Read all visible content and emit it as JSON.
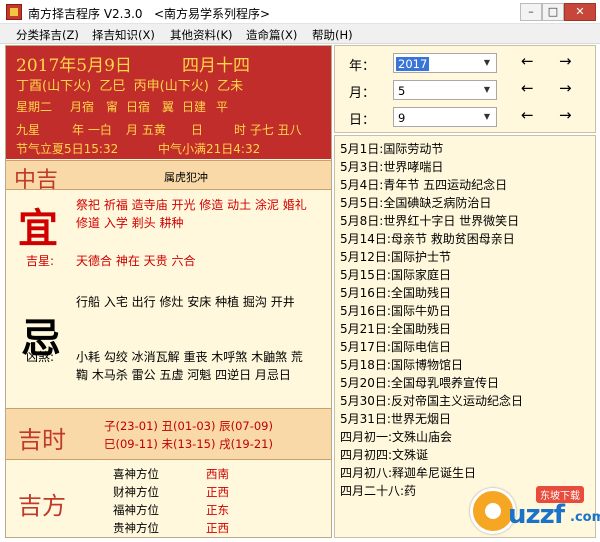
{
  "window": {
    "title": "南方择吉程序 V2.3.0   <南方易学系列程序>",
    "min_label": "–",
    "max_label": "□",
    "close_label": "✕"
  },
  "menu": [
    "分类择吉(Z)",
    "择吉知识(X)",
    "其他资料(K)",
    "造命篇(X)",
    "帮助(H)"
  ],
  "header": {
    "solar_date": "2017年5月9日",
    "lunar_date": "四月十四",
    "ganzhi": "丁酉(山下火)  乙巳  丙申(山下火)  乙未",
    "weekday": "星期二",
    "xiu": "月宿",
    "xiu_name": "甯",
    "ri_xiu": "日宿",
    "ri_xiu_name": "翼",
    "rijian": "日建",
    "rijian_name": "平",
    "jiuxing_label": "九星",
    "year_star": "年 一白",
    "month_star": "月 五黄",
    "day_star": "日",
    "hour_star": "时 子七 丑八",
    "jieqi_prev": "节气立夏5日15:32",
    "jieqi_next": "中气小满21日4:32"
  },
  "day_quality": "中吉",
  "conflict": "属虎犯冲",
  "yi": {
    "char": "宜",
    "line1": "祭祀 祈福 造寺庙 开光 修造 动土 涂泥 婚礼",
    "line2": "修道 入学 剃头 耕种",
    "jishen_label": "吉星:",
    "jishen": "天德合 神在 天贵 六合"
  },
  "ji": {
    "char": "忌",
    "line1": "行船 入宅 出行 修灶 安床 种植 掘沟 开井",
    "xiongsha_label": "凶煞:",
    "xiongsha_line1": "小耗 勾绞 冰消瓦解 重丧 木呼煞 木鼬煞 荒",
    "xiongsha_line2": "鞫 木马杀 雷公 五虚 河魁 四逆日 月忌日"
  },
  "jishi": {
    "title": "吉时",
    "line1": "子(23-01) 丑(01-03) 辰(07-09)",
    "line2": "巳(09-11) 未(13-15) 戌(19-21)"
  },
  "jifang": {
    "title": "吉方",
    "items": [
      {
        "label": "喜神方位",
        "value": "西南"
      },
      {
        "label": "财神方位",
        "value": "正西"
      },
      {
        "label": "福神方位",
        "value": "正东"
      },
      {
        "label": "贵神方位",
        "value": "正西"
      }
    ]
  },
  "selectors": {
    "year_label": "年：",
    "year_value": "2017",
    "month_label": "月：",
    "month_value": "5",
    "day_label": "日：",
    "day_value": "9",
    "prev": "←",
    "next": "→"
  },
  "festivals": [
    "5月1日:国际劳动节",
    "5月3日:世界哮喘日",
    "5月4日:青年节 五四运动纪念日",
    "5月5日:全国碘缺乏病防治日",
    "5月8日:世界红十字日 世界微笑日",
    "5月14日:母亲节 救助贫困母亲日",
    "5月12日:国际护士节",
    "5月15日:国际家庭日",
    "5月16日:全国助残日",
    "5月16日:国际牛奶日",
    "5月21日:全国助残日",
    "5月17日:国际电信日",
    "5月18日:国际博物馆日",
    "5月20日:全国母乳喂养宣传日",
    "5月30日:反对帝国主义运动纪念日",
    "5月31日:世界无烟日",
    "四月初一:文殊山庙会",
    "四月初四:文殊诞",
    "四月初八:释迦牟尼诞生日",
    "四月二十八:药"
  ],
  "watermark": {
    "text": "uzzf",
    "badge": "东坡下载",
    "suffix": ".com"
  }
}
